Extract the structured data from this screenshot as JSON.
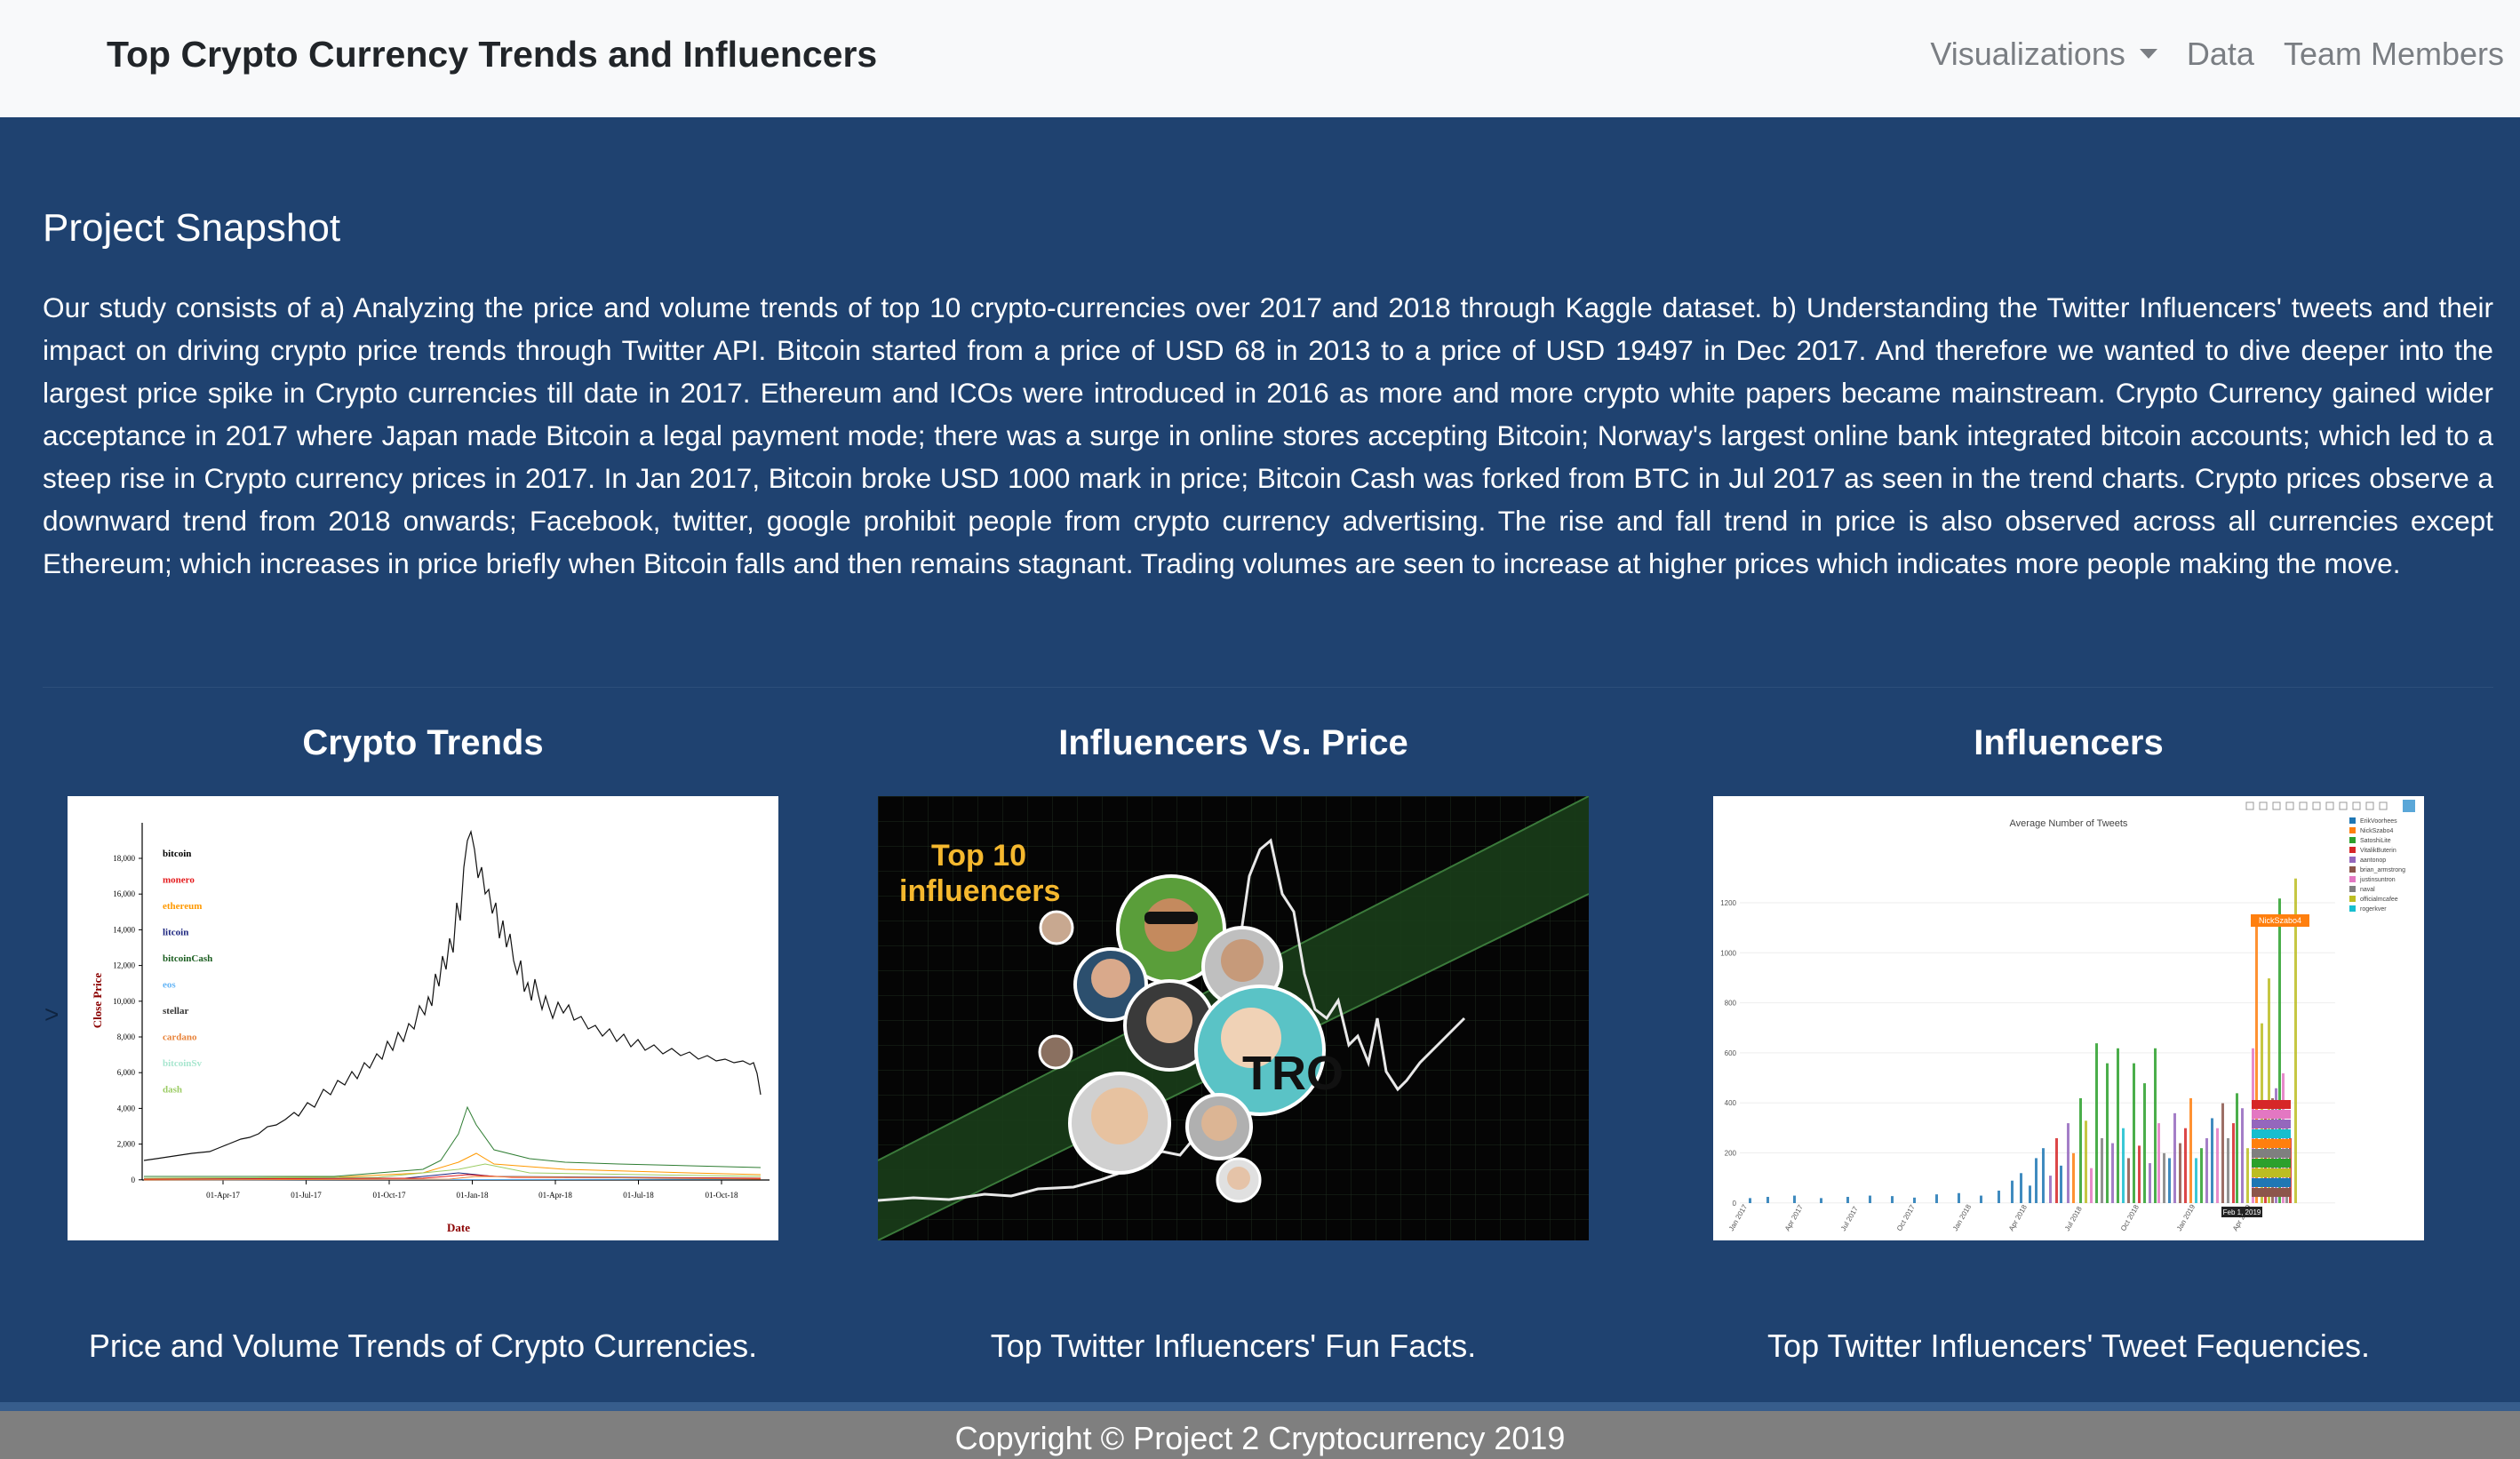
{
  "navbar": {
    "brand": "Top Crypto Currency Trends and Influencers",
    "links": [
      "Visualizations",
      "Data",
      "Team Members"
    ]
  },
  "snapshot": {
    "title": "Project Snapshot",
    "text": "Our study consists of a) Analyzing the price and volume trends of top 10 crypto-currencies over 2017 and 2018 through Kaggle dataset. b) Understanding the Twitter Influencers' tweets and their impact on driving crypto price trends through Twitter API. Bitcoin started from a price of USD 68 in 2013 to a price of USD 19497 in Dec 2017. And therefore we wanted to dive deeper into the largest price spike in Crypto currencies till date in 2017. Ethereum and ICOs were introduced in 2016 as more and more crypto white papers became mainstream. Crypto Currency gained wider acceptance in 2017 where Japan made Bitcoin a legal payment mode; there was a surge in online stores accepting Bitcoin; Norway's largest online bank integrated bitcoin accounts; which led to a steep rise in Crypto currency prices in 2017. In Jan 2017, Bitcoin broke USD 1000 mark in price; Bitcoin Cash was forked from BTC in Jul 2017 as seen in the trend charts. Crypto prices observe a downward trend from 2018 onwards; Facebook, twitter, google prohibit people from crypto currency advertising. The rise and fall trend in price is also observed across all currencies except Ethereum; which increases in price briefly when Bitcoin falls and then remains stagnant. Trading volumes are seen to increase at higher prices which indicates more people making the move."
  },
  "side_arrow": ">",
  "columns": [
    {
      "title": "Crypto Trends",
      "caption": "Price and Volume Trends of Crypto Currencies.",
      "chart": {
        "ylabel": "Close Price",
        "xlabel": "Date",
        "yticks": [
          "18,000",
          "16,000",
          "14,000",
          "12,000",
          "10,000",
          "8,000",
          "6,000",
          "4,000",
          "2,000",
          "0"
        ],
        "xticks": [
          "01-Apr-17",
          "01-Jul-17",
          "01-Oct-17",
          "01-Jan-18",
          "01-Apr-18",
          "01-Jul-18",
          "01-Oct-18"
        ],
        "legend": [
          {
            "name": "bitcoin",
            "color": "#000000"
          },
          {
            "name": "monero",
            "color": "#e41a1c"
          },
          {
            "name": "ethereum",
            "color": "#ff9900"
          },
          {
            "name": "litcoin",
            "color": "#1a237e"
          },
          {
            "name": "bitcoinCash",
            "color": "#1b5e20"
          },
          {
            "name": "eos",
            "color": "#64b5f6"
          },
          {
            "name": "stellar",
            "color": "#333333"
          },
          {
            "name": "cardano",
            "color": "#e8833a"
          },
          {
            "name": "bitcoinSv",
            "color": "#a8e6cf"
          },
          {
            "name": "dash",
            "color": "#9ccc65"
          }
        ]
      }
    },
    {
      "title": "Influencers Vs. Price",
      "caption": "Top Twitter Influencers' Fun Facts.",
      "image": {
        "line1": "Top 10",
        "line2": "influencers",
        "logo": "TRO"
      }
    },
    {
      "title": "Influencers",
      "caption": "Top Twitter Influencers' Tweet Fequencies.",
      "chart": {
        "title": "Average Number of Tweets",
        "yticks": [
          "1200",
          "1000",
          "800",
          "600",
          "400",
          "200",
          "0"
        ],
        "xticks": [
          "Jan 2017",
          "Apr 2017",
          "Jul 2017",
          "Oct 2017",
          "Jan 2018",
          "Apr 2018",
          "Jul 2018",
          "Oct 2018",
          "Jan 2019",
          "Apr 2019"
        ],
        "legend": [
          {
            "name": "ErikVoorhees",
            "color": "#1f77b4"
          },
          {
            "name": "NickSzabo4",
            "color": "#ff7f0e"
          },
          {
            "name": "SatoshiLite",
            "color": "#2ca02c"
          },
          {
            "name": "VitalikButerin",
            "color": "#d62728"
          },
          {
            "name": "aantonop",
            "color": "#9467bd"
          },
          {
            "name": "brian_armstrong",
            "color": "#8c564b"
          },
          {
            "name": "justinsuntron",
            "color": "#e377c2"
          },
          {
            "name": "naval",
            "color": "#7f7f7f"
          },
          {
            "name": "officialmcafee",
            "color": "#bcbd22"
          },
          {
            "name": "rogerkver",
            "color": "#17becf"
          }
        ],
        "tooltip": "NickSzabo4",
        "hover_date": "Feb 1, 2019"
      }
    }
  ],
  "footer": {
    "text": "Copyright © Project 2 Cryptocurrency 2019"
  }
}
